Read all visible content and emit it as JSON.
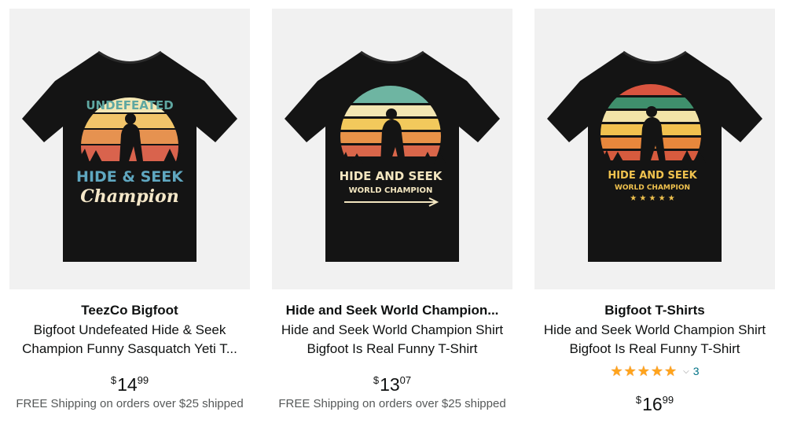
{
  "products": [
    {
      "brand": "TeezCo Bigfoot",
      "title_line1": "Bigfoot Undefeated Hide & Seek",
      "title_line2": "Champion Funny Sasquatch Yeti T...",
      "price_symbol": "$",
      "price_whole": "14",
      "price_fraction": "99",
      "shipping": "FREE Shipping on orders over $25 shipped",
      "shirt_text": {
        "arc": "UNDEFEATED",
        "main": "HIDE & SEEK",
        "script": "Champion"
      }
    },
    {
      "brand": "Hide and Seek World Champion...",
      "title_line1": "Hide and Seek World Champion Shirt",
      "title_line2": "Bigfoot Is Real Funny T-Shirt",
      "price_symbol": "$",
      "price_whole": "13",
      "price_fraction": "07",
      "shipping": "FREE Shipping on orders over $25 shipped",
      "shirt_text": {
        "main": "HIDE AND SEEK",
        "sub": "WORLD CHAMPION"
      }
    },
    {
      "brand": "Bigfoot T-Shirts",
      "title_line1": "Hide and Seek World Champion Shirt",
      "title_line2": "Bigfoot Is Real Funny T-Shirt",
      "rating_stars": 5,
      "rating_count": "3",
      "price_symbol": "$",
      "price_whole": "16",
      "price_fraction": "99",
      "shirt_text": {
        "main": "HIDE AND SEEK",
        "sub": "WORLD CHAMPION",
        "stars": "★ ★ ★ ★ ★"
      }
    }
  ],
  "icons": {
    "star": "star-icon",
    "chevron": "chevron-down-icon"
  },
  "colors": {
    "price_text": "#0f1111",
    "shipping_text": "#565959",
    "rating_star": "#ffa41c",
    "link": "#007185",
    "image_bg": "#f1f1f1",
    "shirt": "#141414"
  }
}
